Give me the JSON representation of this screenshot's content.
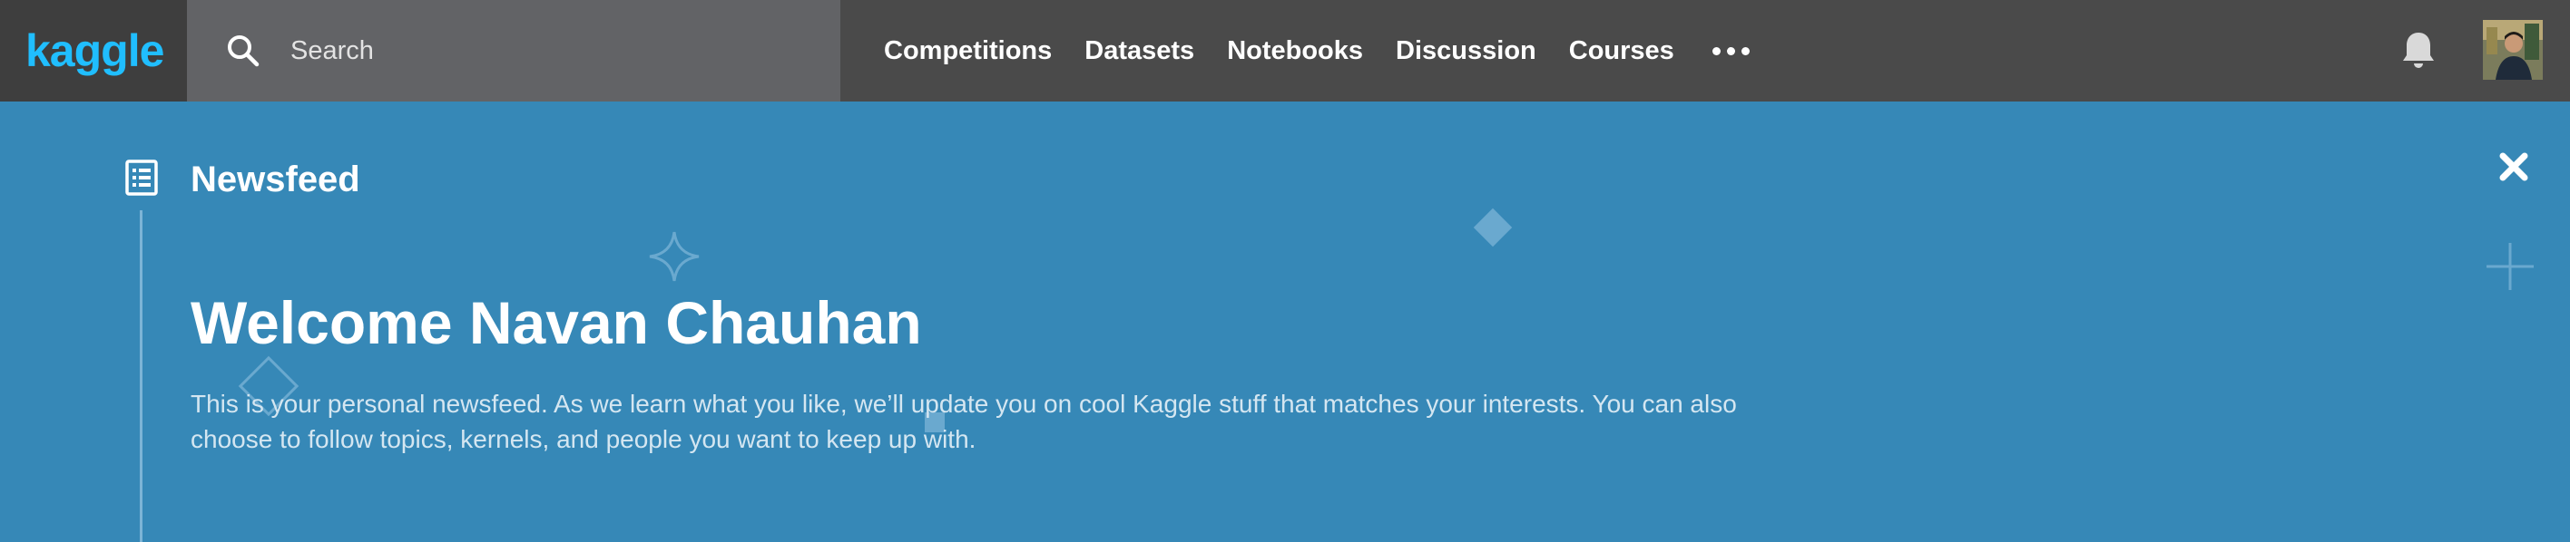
{
  "header": {
    "logo_text": "kaggle",
    "search": {
      "placeholder": "Search",
      "value": ""
    },
    "nav": [
      {
        "label": "Competitions"
      },
      {
        "label": "Datasets"
      },
      {
        "label": "Notebooks"
      },
      {
        "label": "Discussion"
      },
      {
        "label": "Courses"
      }
    ],
    "more_icon": "more-horizontal-icon",
    "notification_icon": "bell-icon",
    "avatar_icon": "user-avatar"
  },
  "newsfeed": {
    "section_title": "Newsfeed",
    "section_icon": "list-icon",
    "close_icon": "close-icon",
    "welcome_title": "Welcome Navan Chauhan",
    "description": "This is your personal newsfeed. As we learn what you like, we’ll update you on cool Kaggle stuff that matches your interests. You can also choose to follow topics, kernels, and people you want to keep up with."
  },
  "colors": {
    "topbar": "#4a4a4a",
    "search_bg": "#626366",
    "hero_bg": "#3688b7",
    "logo": "#20beff"
  }
}
